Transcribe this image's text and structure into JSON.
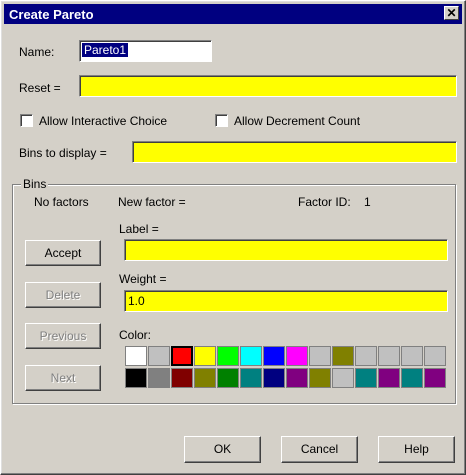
{
  "window": {
    "title": "Create Pareto",
    "close_glyph": "✕"
  },
  "name": {
    "label": "Name:",
    "value": "Pareto1"
  },
  "reset": {
    "label": "Reset =",
    "value": ""
  },
  "options": {
    "allow_interactive": "Allow Interactive Choice",
    "allow_decrement": "Allow Decrement Count"
  },
  "bins_to_display": {
    "label": "Bins to display =",
    "value": ""
  },
  "bins": {
    "group_label": "Bins",
    "no_factors": "No factors",
    "new_factor": "New factor =",
    "factor_id_label": "Factor ID:",
    "factor_id_value": "1",
    "label_label": "Label =",
    "label_value": "",
    "weight_label": "Weight =",
    "weight_value": "1.0",
    "color_label": "Color:",
    "buttons": {
      "accept": "Accept",
      "delete": "Delete",
      "previous": "Previous",
      "next": "Next"
    },
    "palette_row1": [
      "#ffffff",
      "#c0c0c0",
      "#ff0000",
      "#ffff00",
      "#00ff00",
      "#00ffff",
      "#0000ff",
      "#ff00ff",
      "#c0c0c0",
      "#808000",
      "#c0c0c0",
      "#c0c0c0",
      "#c0c0c0",
      "#c0c0c0"
    ],
    "palette_row2": [
      "#000000",
      "#808080",
      "#800000",
      "#808000",
      "#008000",
      "#008080",
      "#000080",
      "#800080",
      "#808000",
      "#c0c0c0",
      "#008080",
      "#800080",
      "#008080",
      "#800080"
    ],
    "selected_color_index": 2
  },
  "footer": {
    "ok": "OK",
    "cancel": "Cancel",
    "help": "Help"
  }
}
